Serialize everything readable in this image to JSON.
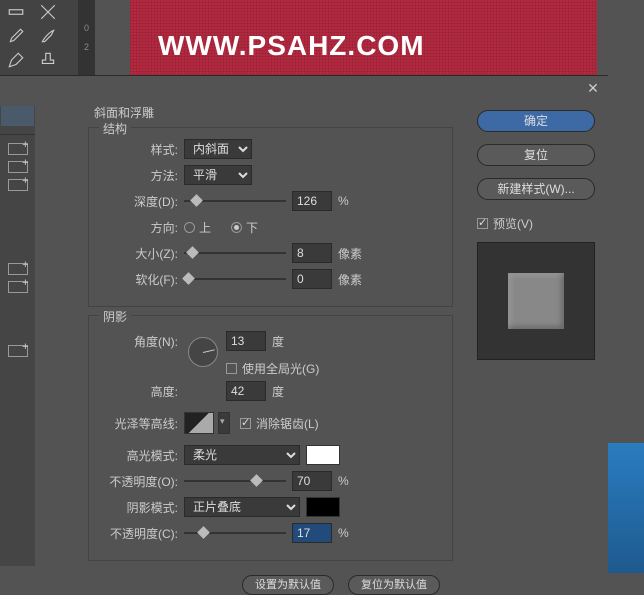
{
  "background": {
    "canvas_text": "WWW.PSAHZ.COM",
    "ruler_values": [
      "",
      "0",
      "2"
    ]
  },
  "dialog": {
    "section_title": "斜面和浮雕",
    "structure": {
      "legend": "结构",
      "style_label": "样式:",
      "style_value": "内斜面",
      "method_label": "方法:",
      "method_value": "平滑",
      "depth_label": "深度(D):",
      "depth_value": "126",
      "depth_unit": "%",
      "direction_label": "方向:",
      "direction_up": "上",
      "direction_down": "下",
      "size_label": "大小(Z):",
      "size_value": "8",
      "size_unit": "像素",
      "soften_label": "软化(F):",
      "soften_value": "0",
      "soften_unit": "像素"
    },
    "shading": {
      "legend": "阴影",
      "angle_label": "角度(N):",
      "angle_value": "13",
      "angle_unit": "度",
      "global_light_label": "使用全局光(G)",
      "altitude_label": "高度:",
      "altitude_value": "42",
      "altitude_unit": "度",
      "gloss_contour_label": "光泽等高线:",
      "antialias_label": "消除锯齿(L)",
      "highlight_mode_label": "高光模式:",
      "highlight_mode_value": "柔光",
      "highlight_color": "#ffffff",
      "highlight_opacity_label": "不透明度(O):",
      "highlight_opacity_value": "70",
      "highlight_opacity_unit": "%",
      "shadow_mode_label": "阴影模式:",
      "shadow_mode_value": "正片叠底",
      "shadow_color": "#000000",
      "shadow_opacity_label": "不透明度(C):",
      "shadow_opacity_value": "17",
      "shadow_opacity_unit": "%"
    },
    "bottom": {
      "make_default": "设置为默认值",
      "reset_default": "复位为默认值"
    }
  },
  "right": {
    "ok": "确定",
    "reset": "复位",
    "new_style": "新建样式(W)...",
    "preview": "预览(V)"
  }
}
